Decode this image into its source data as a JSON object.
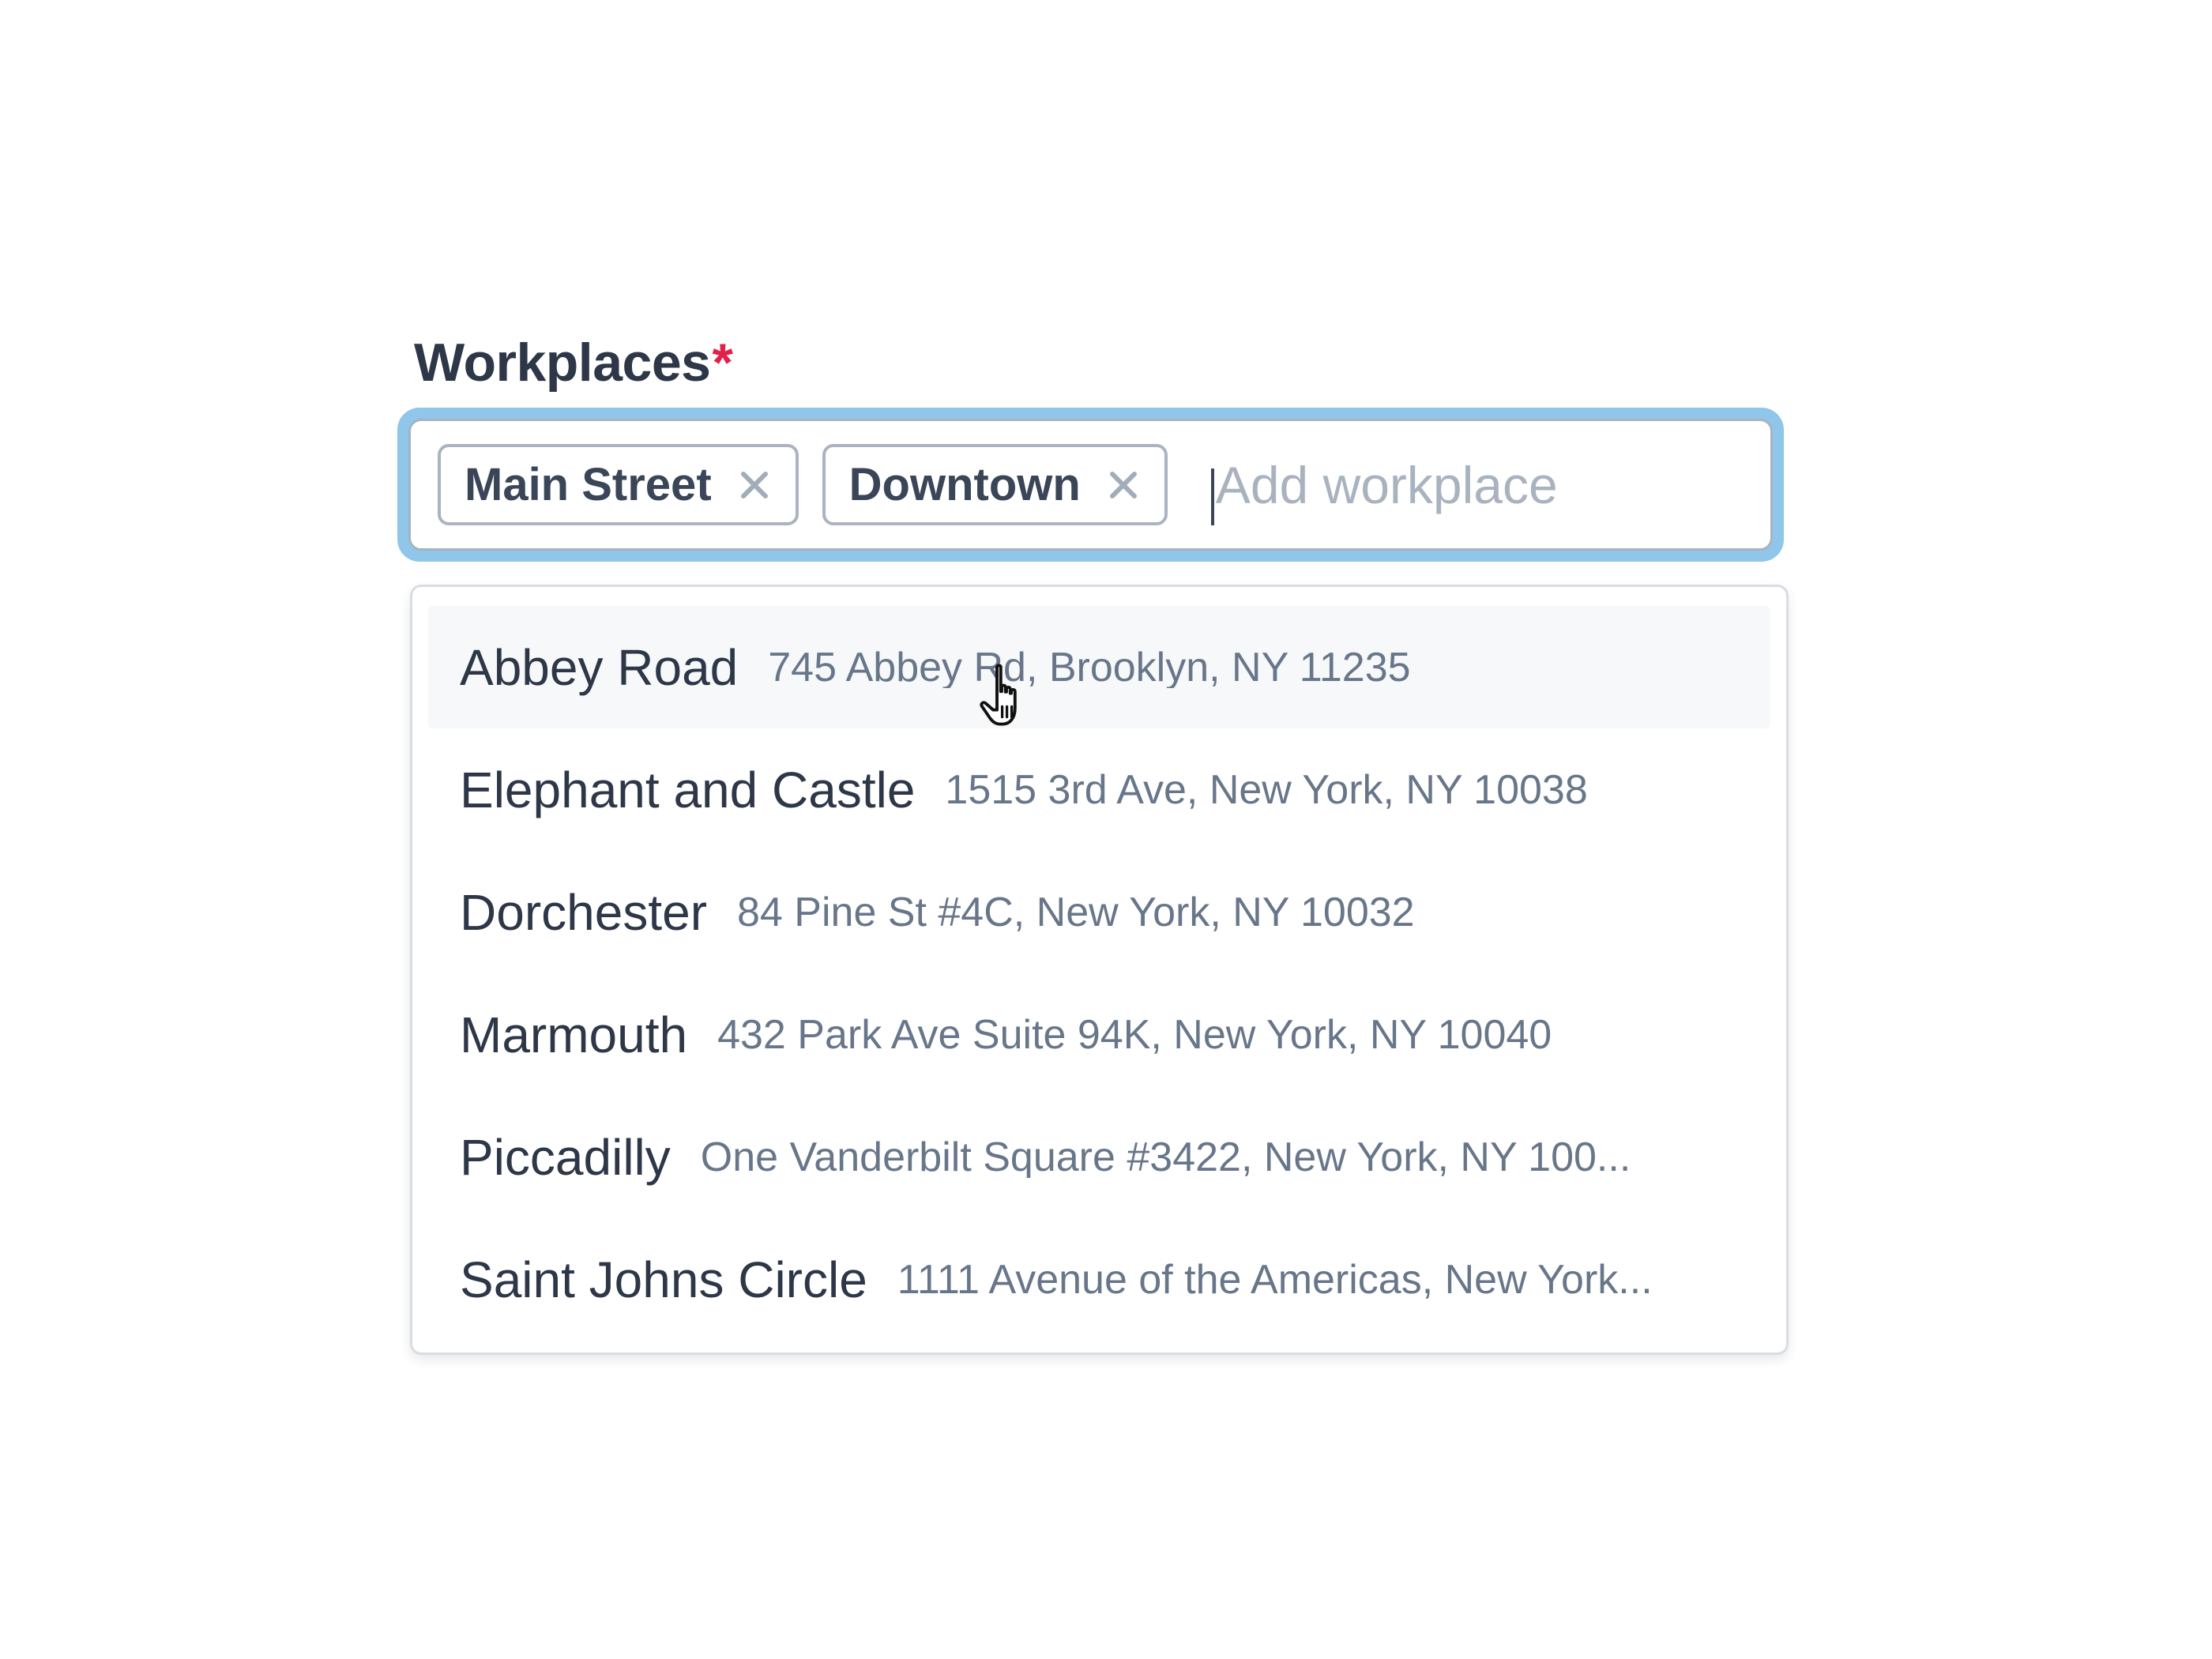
{
  "field": {
    "label": "Workplaces",
    "required_mark": "*"
  },
  "selected_tags": [
    {
      "label": "Main Street"
    },
    {
      "label": "Downtown"
    }
  ],
  "input": {
    "value": "",
    "placeholder": "Add workplace"
  },
  "options": [
    {
      "name": "Abbey Road",
      "address": "745 Abbey Rd, Brooklyn, NY 11235",
      "highlighted": true
    },
    {
      "name": "Elephant and Castle",
      "address": "1515 3rd Ave, New York, NY 10038"
    },
    {
      "name": "Dorchester",
      "address": "84 Pine St #4C, New York, NY 10032"
    },
    {
      "name": "Marmouth",
      "address": "432 Park Ave Suite 94K, New York, NY 10040"
    },
    {
      "name": "Piccadilly",
      "address": "One Vanderbilt Square #3422, New York, NY 100..."
    },
    {
      "name": "Saint Johns Circle",
      "address": "1111 Avenue of the Americas, New York..."
    }
  ],
  "colors": {
    "focus_ring": "#8fc6ea",
    "required": "#e0214a",
    "text_primary": "#2d3748",
    "text_secondary": "#68768a",
    "placeholder": "#a9b3bf"
  },
  "icons": {
    "tag_remove": "close-icon",
    "pointer": "hand-pointer-icon"
  }
}
